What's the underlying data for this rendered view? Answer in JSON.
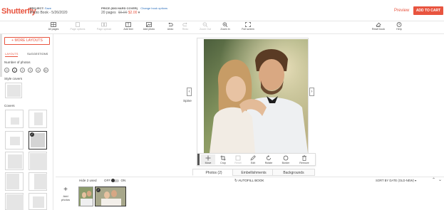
{
  "header": {
    "logo": "Shutterfly",
    "project_label": "PROJECT:",
    "project_action": "Save",
    "project_name": "Photo Book - 5/26/2020",
    "price_label": "PRICE (8x8 Hard Cover)",
    "price_change": "Change book options",
    "pages": "20 pages",
    "old_price": "$6.99",
    "new_price": "$2.00",
    "preview": "Preview",
    "add_to_cart": "ADD TO CART"
  },
  "toolbar": {
    "left": [
      {
        "label": "All pages",
        "icon": "grid-icon",
        "enabled": true
      },
      {
        "label": "Page options",
        "icon": "page-icon",
        "enabled": false
      },
      {
        "label": "Page spread",
        "icon": "spread-icon",
        "enabled": false
      },
      {
        "label": "Add text",
        "icon": "text-icon",
        "enabled": true
      },
      {
        "label": "Add photo",
        "icon": "photo-icon",
        "enabled": true
      },
      {
        "label": "Undo",
        "icon": "undo-icon",
        "enabled": true
      },
      {
        "label": "Redo",
        "icon": "redo-icon",
        "enabled": false
      },
      {
        "label": "Zoom Out",
        "icon": "zoom-out-icon",
        "enabled": false
      },
      {
        "label": "Zoom In",
        "icon": "zoom-in-icon",
        "enabled": true
      },
      {
        "label": "Full screen",
        "icon": "fullscreen-icon",
        "enabled": true
      }
    ],
    "right": [
      {
        "label": "Reset book",
        "icon": "eraser-icon"
      },
      {
        "label": "Help",
        "icon": "help-icon"
      }
    ]
  },
  "left_panel": {
    "more_layouts": "+ MORE LAYOUTS",
    "tabs": [
      "LAYOUTS",
      "SUGGESTIONS"
    ],
    "number_label": "Number of photos",
    "numbers": [
      "0",
      "1",
      "2",
      "3",
      "4",
      "5+"
    ],
    "style_covers": "Style covers",
    "covers": "Covers"
  },
  "canvas": {
    "spine": "Spine",
    "prev": "‹",
    "next": "›"
  },
  "photo_tools": [
    {
      "label": "Move",
      "icon": "move-icon",
      "enabled": true
    },
    {
      "label": "Crop",
      "icon": "crop-icon",
      "enabled": true
    },
    {
      "label": "Reset",
      "icon": "reset-icon",
      "enabled": false
    },
    {
      "label": "Edit",
      "icon": "pencil-icon",
      "enabled": true
    },
    {
      "label": "Rotate",
      "icon": "rotate-icon",
      "enabled": true
    },
    {
      "label": "Border",
      "icon": "border-icon",
      "enabled": true
    },
    {
      "label": "Remove",
      "icon": "trash-icon",
      "enabled": true
    }
  ],
  "bottom": {
    "tabs": [
      "Photos (2)",
      "Embellishments",
      "Backgrounds"
    ],
    "hide_used": "Hide 2 used",
    "off": "OFF",
    "on": "ON",
    "autofill": "AUTOFILL BOOK",
    "sort": "SORT BY DATE (OLD-NEW)",
    "add_photos": "Add photos",
    "add_plus": "+"
  }
}
